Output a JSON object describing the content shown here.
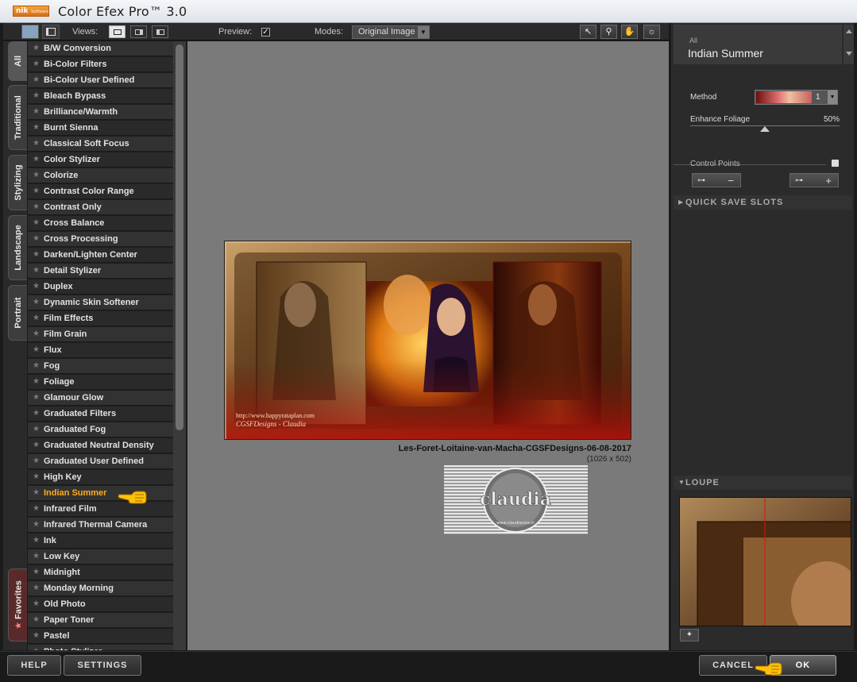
{
  "window": {
    "logo_top": "nik",
    "logo_sub": "Software",
    "title": "Color Efex Pro™ 3.0"
  },
  "toolbar": {
    "views_label": "Views:",
    "preview_label": "Preview:",
    "preview_checked": true,
    "preview_check_glyph": "✓",
    "modes_label": "Modes:",
    "modes_value": "Original Image",
    "tools": [
      "arrow-icon",
      "zoom-icon",
      "hand-icon",
      "light-icon"
    ]
  },
  "tabs": [
    {
      "label": "All",
      "active": true
    },
    {
      "label": "Traditional",
      "active": false
    },
    {
      "label": "Stylizing",
      "active": false
    },
    {
      "label": "Landscape",
      "active": false
    },
    {
      "label": "Portrait",
      "active": false
    },
    {
      "label": "Favorites",
      "active": false,
      "icon": "★"
    }
  ],
  "filters": [
    "B/W Conversion",
    "Bi-Color Filters",
    "Bi-Color User Defined",
    "Bleach Bypass",
    "Brilliance/Warmth",
    "Burnt Sienna",
    "Classical Soft Focus",
    "Color Stylizer",
    "Colorize",
    "Contrast Color Range",
    "Contrast Only",
    "Cross Balance",
    "Cross Processing",
    "Darken/Lighten Center",
    "Detail Stylizer",
    "Duplex",
    "Dynamic Skin Softener",
    "Film Effects",
    "Film Grain",
    "Flux",
    "Fog",
    "Foliage",
    "Glamour Glow",
    "Graduated Filters",
    "Graduated Fog",
    "Graduated Neutral Density",
    "Graduated User Defined",
    "High Key",
    "Indian Summer",
    "Infrared Film",
    "Infrared Thermal Camera",
    "Ink",
    "Low Key",
    "Midnight",
    "Monday Morning",
    "Old Photo",
    "Paper Toner",
    "Pastel",
    "Photo Stylizer"
  ],
  "selected_filter": "Indian Summer",
  "preview": {
    "image_caption": "Les-Foret-Loitaine-van-Macha-CGSFDesigns-06-08-2017",
    "image_size": "(1026 x 502)",
    "image_url_text": "http://www.happyrataplan.com",
    "image_credit": "CGSFDesigns - Claudia",
    "watermark_text": "claudia",
    "watermark_sub": "www.claudiaviza.nl"
  },
  "panel": {
    "category": "All",
    "filter_name": "Indian Summer",
    "method_label": "Method",
    "method_value": "1",
    "enhance_label": "Enhance Foliage",
    "enhance_value": "50%",
    "enhance_fraction": 0.5,
    "control_points_label": "Control Points",
    "control_points_minus": "−",
    "control_points_plus": "+",
    "quick_save_label": "QUICK SAVE SLOTS",
    "loupe_label": "LOUPE"
  },
  "bottom": {
    "help": "HELP",
    "settings": "SETTINGS",
    "cancel": "CANCEL",
    "ok": "OK"
  },
  "colors": {
    "selected_item": "#ffae1a",
    "preview_bg": "#7a7a7a",
    "panel_bg": "#2b2b2b"
  }
}
